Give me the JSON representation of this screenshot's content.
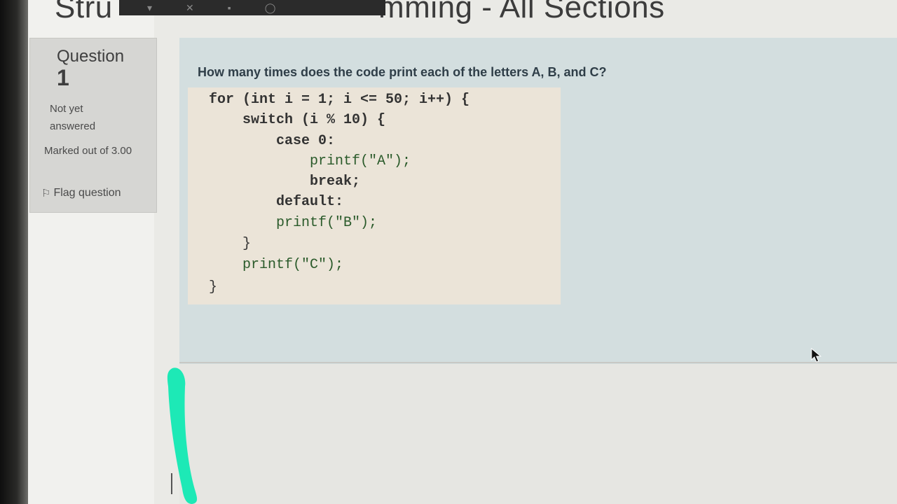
{
  "page": {
    "heading_left": "Stru",
    "heading_right": "mming - All Sections"
  },
  "question_info": {
    "label": "Question",
    "number": "1",
    "state": "Not yet answered",
    "grade": "Marked out of 3.00",
    "flag_label": "Flag question"
  },
  "question": {
    "text": "How many times does the code print each of the letters A, B, and C?",
    "code_lines": [
      "for (int i = 1; i <= 50; i++) {",
      "    switch (i % 10) {",
      "        case 0:",
      "            printf(\"A\");",
      "            break;",
      "        default:",
      "        printf(\"B\");",
      "    }",
      "    printf(\"C\");",
      "}"
    ]
  },
  "icons": {
    "flag": "flag-icon",
    "cursor": "mouse-pointer-icon",
    "toolbar": [
      "camera-icon",
      "mic-off-icon",
      "chat-icon",
      "share-icon"
    ]
  },
  "colors": {
    "question_panel": "#d3dedf",
    "code_background": "#ebe4d8",
    "info_box": "#d6d6d3",
    "teal_mark": "#1de9b6",
    "question_text": "#2f3e48"
  }
}
